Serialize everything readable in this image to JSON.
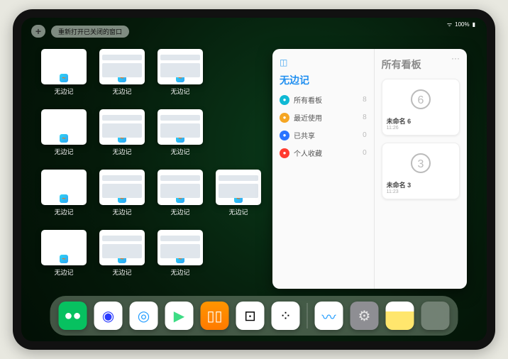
{
  "statusbar": {
    "wifi": "ᯤ",
    "battery_pct": "100%"
  },
  "topbar": {
    "add_label": "+",
    "reopen_label": "重新打开已关闭的窗口"
  },
  "thumbnails": {
    "app_label": "无边记",
    "items": [
      {
        "variant": "blank"
      },
      {
        "variant": "detail"
      },
      {
        "variant": "detail"
      },
      {
        "variant": "blank"
      },
      {
        "variant": "detail"
      },
      {
        "variant": "detail"
      },
      {
        "variant": "blank"
      },
      {
        "variant": "detail"
      },
      {
        "variant": "detail"
      },
      {
        "variant": "detail"
      },
      {
        "variant": "blank"
      },
      {
        "variant": "detail"
      },
      {
        "variant": "detail"
      }
    ]
  },
  "panel": {
    "more": "···",
    "left_title": "无边记",
    "right_title": "所有看板",
    "categories": [
      {
        "icon_color": "#0fb9d4",
        "label": "所有看板",
        "count": 8
      },
      {
        "icon_color": "#f5a623",
        "label": "最近使用",
        "count": 8
      },
      {
        "icon_color": "#2b74ff",
        "label": "已共享",
        "count": 0
      },
      {
        "icon_color": "#ff3b30",
        "label": "个人收藏",
        "count": 0
      }
    ],
    "boards": [
      {
        "name": "未命名 6",
        "time": "11:26",
        "digit": "6"
      },
      {
        "name": "未命名 3",
        "time": "11:23",
        "digit": "3"
      }
    ]
  },
  "dock": {
    "apps": [
      {
        "name": "wechat",
        "bg": "#07c160",
        "glyph": "●●",
        "fg": "#fff"
      },
      {
        "name": "quark",
        "bg": "#ffffff",
        "glyph": "◉",
        "fg": "#2a3bff"
      },
      {
        "name": "qqbrowser",
        "bg": "#ffffff",
        "glyph": "◎",
        "fg": "#1e9bff"
      },
      {
        "name": "play",
        "bg": "#ffffff",
        "glyph": "▶",
        "fg": "#3ddc84"
      },
      {
        "name": "books",
        "bg": "linear-gradient(#ff9500,#ff7a00)",
        "glyph": "▯▯",
        "fg": "#fff"
      },
      {
        "name": "dice",
        "bg": "#ffffff",
        "glyph": "⊡",
        "fg": "#000"
      },
      {
        "name": "nodes",
        "bg": "#ffffff",
        "glyph": "⁘",
        "fg": "#000"
      }
    ],
    "recent": [
      {
        "name": "freeform",
        "bg": "#ffffff",
        "glyph": "〰",
        "fg": "#1e9bff"
      },
      {
        "name": "settings",
        "bg": "#8e8e93",
        "glyph": "⚙",
        "fg": "#e5e5e5"
      },
      {
        "name": "notes",
        "bg": "linear-gradient(#fff 35%,#ffe66d 35%)",
        "glyph": "",
        "fg": "#000"
      }
    ]
  }
}
